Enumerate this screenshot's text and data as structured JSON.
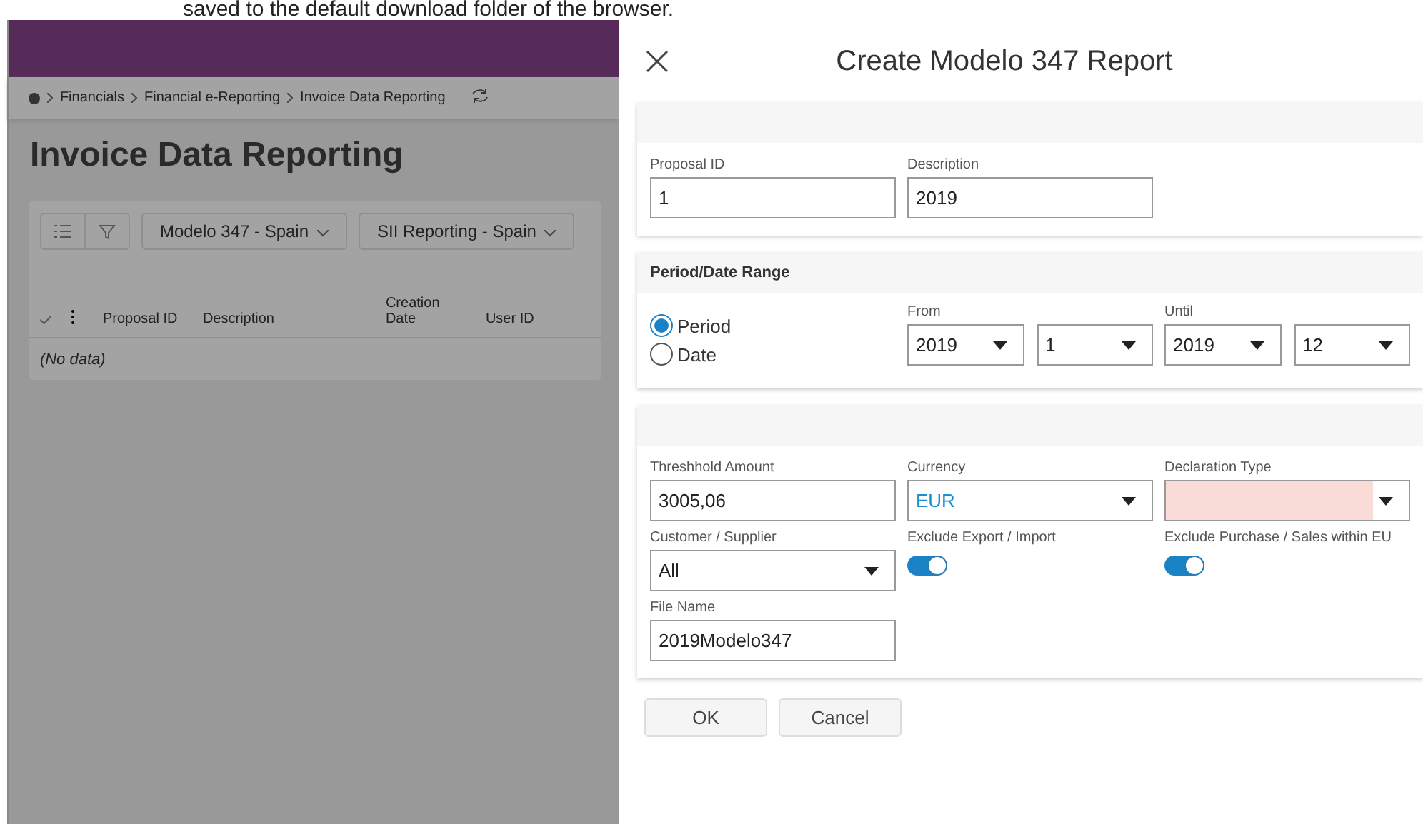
{
  "doc_text": "saved to the default download folder of the browser.",
  "background": {
    "breadcrumb": [
      "Financials",
      "Financial e-Reporting",
      "Invoice Data Reporting"
    ],
    "page_title": "Invoice Data Reporting",
    "filters": [
      {
        "label": "Modelo 347 - Spain"
      },
      {
        "label": "SII Reporting - Spain"
      }
    ],
    "table": {
      "columns": [
        "Proposal ID",
        "Description",
        "Creation Date",
        "User ID"
      ],
      "empty_text": "(No data)"
    }
  },
  "dialog": {
    "title": "Create Modelo 347 Report",
    "sections": [
      {
        "kind": "fields",
        "fields": [
          {
            "kind": "text",
            "label": "Proposal ID",
            "value": "1"
          },
          {
            "kind": "text",
            "label": "Description",
            "value": "2019"
          }
        ]
      },
      {
        "kind": "range",
        "heading": "Period/Date Range",
        "options": [
          {
            "label": "Period",
            "selected": true
          },
          {
            "label": "Date",
            "selected": false
          }
        ],
        "ranges": [
          {
            "label": "From",
            "selects": [
              "2019",
              "1"
            ]
          },
          {
            "label": "Until",
            "selects": [
              "2019",
              "12"
            ]
          }
        ]
      },
      {
        "kind": "fields",
        "fields": [
          {
            "kind": "text",
            "label": "Threshhold Amount",
            "value": "3005,06"
          },
          {
            "kind": "lookup",
            "label": "Currency",
            "value": "EUR"
          },
          {
            "kind": "select",
            "label": "Declaration Type",
            "invalid": true
          },
          {
            "kind": "select",
            "label": "Customer / Supplier",
            "value": "All"
          },
          {
            "kind": "toggle",
            "label": "Exclude Export / Import",
            "on": true
          },
          {
            "kind": "toggle",
            "label": "Exclude Purchase / Sales within EU",
            "on": true
          },
          {
            "kind": "text",
            "label": "File Name",
            "value": "2019Modelo347"
          }
        ]
      }
    ],
    "buttons": [
      "OK",
      "Cancel"
    ]
  }
}
